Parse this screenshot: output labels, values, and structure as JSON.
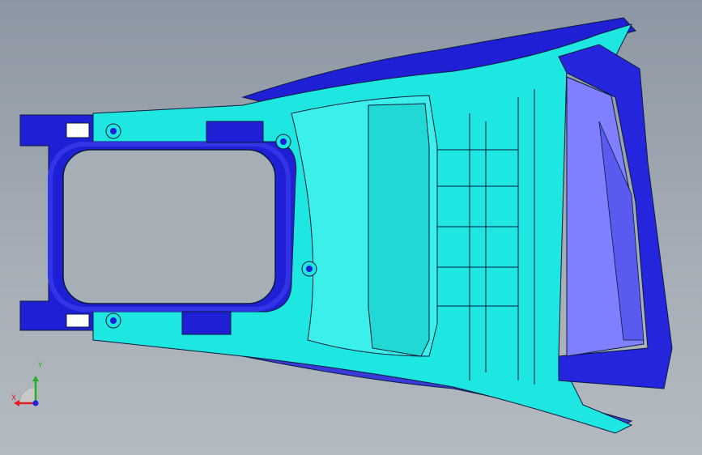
{
  "viewport": {
    "background_top": "#8d97a3",
    "background_bottom": "#b4bac1"
  },
  "model": {
    "primary_color": "#00e5e0",
    "secondary_color": "#1f1fd6",
    "edge_color": "#0a1a3a",
    "highlight_color": "#7f7fff"
  },
  "triad": {
    "x_label": "X",
    "y_label": "Y",
    "x_color": "#e02020",
    "y_color": "#22b022",
    "z_color": "#2020e0"
  }
}
